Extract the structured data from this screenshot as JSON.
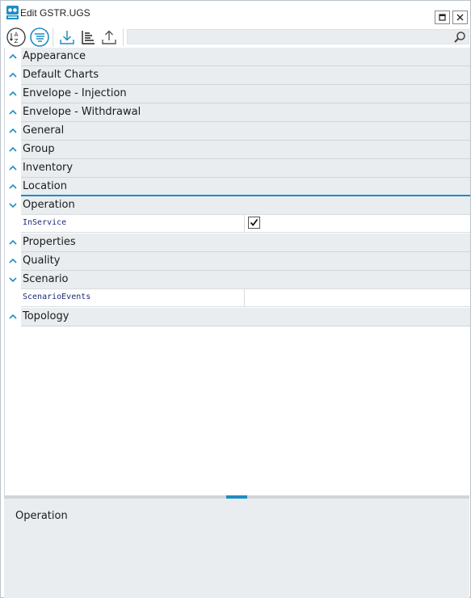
{
  "window": {
    "title": "Edit GSTR.UGS",
    "app_icon": "app-logo-icon",
    "accent_color": "#1e8dc1"
  },
  "toolbar": {
    "sort_alpha_icon": "sort-alphabetical-icon",
    "categorized_icon": "categorized-icon",
    "import_icon": "import-icon",
    "tree_icon": "tree-view-icon",
    "export_icon": "export-icon",
    "search_placeholder": "",
    "search_value": ""
  },
  "categories": [
    {
      "label": "Appearance",
      "expanded": false
    },
    {
      "label": "Default Charts",
      "expanded": false
    },
    {
      "label": "Envelope - Injection",
      "expanded": false
    },
    {
      "label": "Envelope - Withdrawal",
      "expanded": false
    },
    {
      "label": "General",
      "expanded": false
    },
    {
      "label": "Group",
      "expanded": false
    },
    {
      "label": "Inventory",
      "expanded": false
    },
    {
      "label": "Location",
      "expanded": false
    },
    {
      "label": "Operation",
      "expanded": true,
      "properties": [
        {
          "name": "InService",
          "value": true
        }
      ]
    },
    {
      "label": "Properties",
      "expanded": false
    },
    {
      "label": "Quality",
      "expanded": false
    },
    {
      "label": "Scenario",
      "expanded": true,
      "properties": [
        {
          "name": "ScenarioEvents",
          "value": ""
        }
      ]
    },
    {
      "label": "Topology",
      "expanded": false
    }
  ],
  "description": {
    "title": "Operation"
  }
}
